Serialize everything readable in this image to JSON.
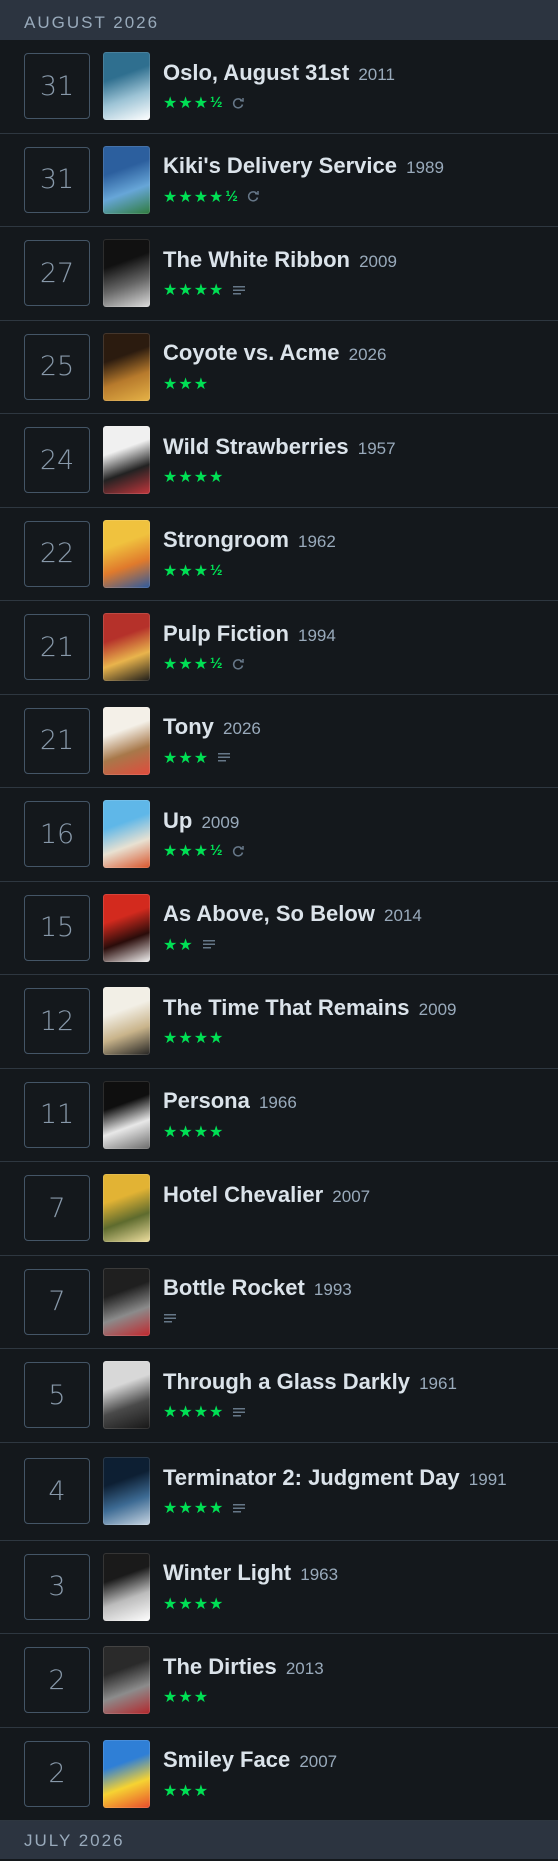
{
  "sections": {
    "current_month": "AUGUST 2026",
    "next_month": "JULY 2026"
  },
  "colors": {
    "star_green": "#00e054",
    "month_bar": "#2c3440",
    "background": "#14181c"
  },
  "entries": [
    {
      "day": "31",
      "title": "Oslo, August 31st",
      "year": "2011",
      "stars": "★★★",
      "half": "½",
      "icons": [
        "rewatch-icon"
      ],
      "poster": [
        "#2f6f8f",
        "#9cc3d5",
        "#ffffff"
      ]
    },
    {
      "day": "31",
      "title": "Kiki's Delivery Service",
      "year": "1989",
      "stars": "★★★★",
      "half": "½",
      "icons": [
        "rewatch-icon"
      ],
      "poster": [
        "#2c5f9e",
        "#67a6d8",
        "#2f7b3c"
      ]
    },
    {
      "day": "27",
      "title": "The White Ribbon",
      "year": "2009",
      "stars": "★★★★",
      "half": "",
      "icons": [
        "review-icon"
      ],
      "poster": [
        "#111111",
        "#666666",
        "#dddddd"
      ]
    },
    {
      "day": "25",
      "title": "Coyote vs. Acme",
      "year": "2026",
      "stars": "★★★",
      "half": "",
      "icons": [],
      "poster": [
        "#2b1b0f",
        "#b77a2c",
        "#e6b347"
      ]
    },
    {
      "day": "24",
      "title": "Wild Strawberries",
      "year": "1957",
      "stars": "★★★★",
      "half": "",
      "icons": [],
      "poster": [
        "#f0f0f0",
        "#222222",
        "#c4363c"
      ]
    },
    {
      "day": "22",
      "title": "Strongroom",
      "year": "1962",
      "stars": "★★★",
      "half": "½",
      "icons": [],
      "poster": [
        "#f0c23e",
        "#e07a2c",
        "#2b5aa0"
      ]
    },
    {
      "day": "21",
      "title": "Pulp Fiction",
      "year": "1994",
      "stars": "★★★",
      "half": "½",
      "icons": [
        "rewatch-icon"
      ],
      "poster": [
        "#b5312a",
        "#e9b44c",
        "#1a1a1a"
      ]
    },
    {
      "day": "21",
      "title": "Tony",
      "year": "2026",
      "stars": "★★★",
      "half": "",
      "icons": [
        "review-icon"
      ],
      "poster": [
        "#f4f0e8",
        "#a8784a",
        "#e24a3c"
      ]
    },
    {
      "day": "16",
      "title": "Up",
      "year": "2009",
      "stars": "★★★",
      "half": "½",
      "icons": [
        "rewatch-icon"
      ],
      "poster": [
        "#5fb7e8",
        "#e8e1d2",
        "#d9542b"
      ]
    },
    {
      "day": "15",
      "title": "As Above, So Below",
      "year": "2014",
      "stars": "★★",
      "half": "",
      "icons": [
        "review-icon"
      ],
      "poster": [
        "#d32a1e",
        "#2a0c0a",
        "#f4f4f4"
      ]
    },
    {
      "day": "12",
      "title": "The Time That Remains",
      "year": "2009",
      "stars": "★★★★",
      "half": "",
      "icons": [],
      "poster": [
        "#f2efe6",
        "#c9b48b",
        "#222222"
      ]
    },
    {
      "day": "11",
      "title": "Persona",
      "year": "1966",
      "stars": "★★★★",
      "half": "",
      "icons": [],
      "poster": [
        "#0f0f0f",
        "#e8e8e8",
        "#6a6a6a"
      ]
    },
    {
      "day": "7",
      "title": "Hotel Chevalier",
      "year": "2007",
      "stars": "",
      "half": "",
      "icons": [],
      "poster": [
        "#e2b334",
        "#5e6b2e",
        "#f0e0a0"
      ]
    },
    {
      "day": "7",
      "title": "Bottle Rocket",
      "year": "1993",
      "stars": "",
      "half": "",
      "icons": [
        "review-icon"
      ],
      "poster": [
        "#1f1f1f",
        "#8b8b8b",
        "#c1272d"
      ]
    },
    {
      "day": "5",
      "title": "Through a Glass Darkly",
      "year": "1961",
      "stars": "★★★★",
      "half": "",
      "icons": [
        "review-icon"
      ],
      "poster": [
        "#d8d8d8",
        "#4a4a4a",
        "#161616"
      ]
    },
    {
      "day": "4",
      "title": "Terminator 2: Judgment Day",
      "year": "1991",
      "stars": "★★★★",
      "half": "",
      "icons": [
        "review-icon"
      ],
      "poster": [
        "#0d1f33",
        "#3d6b94",
        "#c9d6e3"
      ],
      "tall": true
    },
    {
      "day": "3",
      "title": "Winter Light",
      "year": "1963",
      "stars": "★★★★",
      "half": "",
      "icons": [],
      "poster": [
        "#1a1a1a",
        "#bcbcbc",
        "#ffffff"
      ]
    },
    {
      "day": "2",
      "title": "The Dirties",
      "year": "2013",
      "stars": "★★★",
      "half": "",
      "icons": [],
      "poster": [
        "#2a2a2a",
        "#8c8c8c",
        "#b3262b"
      ]
    },
    {
      "day": "2",
      "title": "Smiley Face",
      "year": "2007",
      "stars": "★★★",
      "half": "",
      "icons": [],
      "poster": [
        "#2f7fd6",
        "#f6d332",
        "#e94a2c"
      ]
    }
  ]
}
